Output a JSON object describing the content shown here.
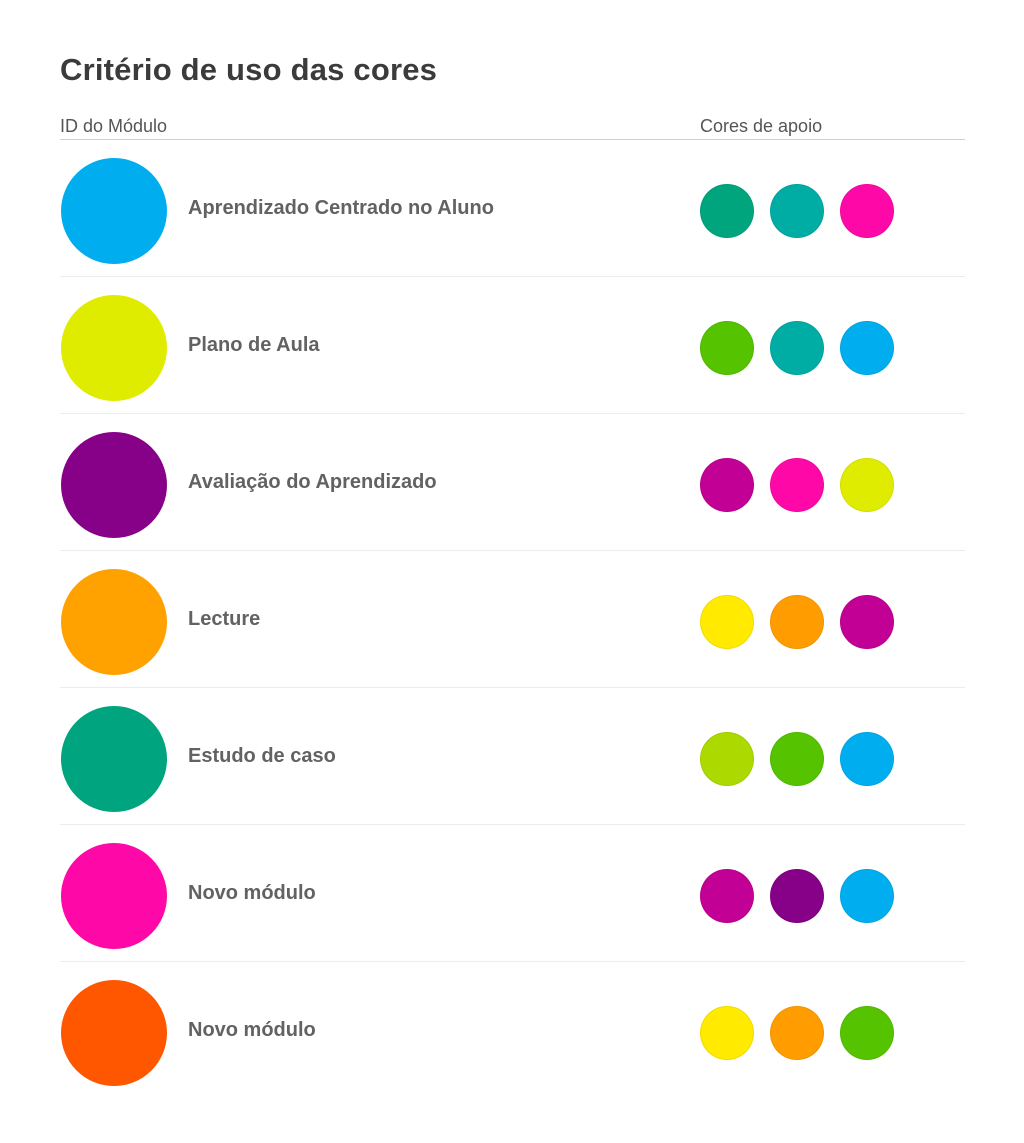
{
  "title": "Critério de uso das cores",
  "headers": {
    "module_id": "ID do Módulo",
    "support_colors": "Cores de apoio"
  },
  "rows": [
    {
      "name": "Aprendizado Centrado no Aluno",
      "color": "#00aeef",
      "support": [
        "#00a57e",
        "#00ada5",
        "#ff08a8"
      ]
    },
    {
      "name": "Plano de Aula",
      "color": "#dfec00",
      "support": [
        "#55c300",
        "#00ada5",
        "#00aeef"
      ]
    },
    {
      "name": "Avaliação do Aprendizado",
      "color": "#870088",
      "support": [
        "#c30095",
        "#ff08a8",
        "#dfec00"
      ]
    },
    {
      "name": "Lecture",
      "color": "#ffa200",
      "support": [
        "#ffea00",
        "#ff9d00",
        "#c30095"
      ]
    },
    {
      "name": "Estudo de caso",
      "color": "#00a47e",
      "support": [
        "#acd900",
        "#55c300",
        "#00aeef"
      ]
    },
    {
      "name": "Novo módulo",
      "color": "#ff08a8",
      "support": [
        "#c30095",
        "#870088",
        "#00aeef"
      ]
    },
    {
      "name": "Novo módulo",
      "color": "#ff5700",
      "support": [
        "#ffea00",
        "#ff9d00",
        "#55c300"
      ]
    }
  ]
}
